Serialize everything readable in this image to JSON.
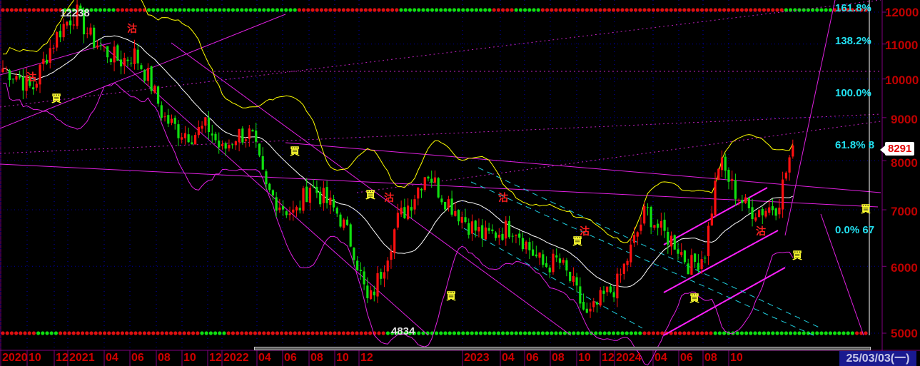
{
  "chart_data": {
    "type": "candlestick",
    "interval": "weekly",
    "y_scale": "log",
    "ylim": [
      4900,
      12300
    ],
    "y_ticks": [
      "12000",
      "11000",
      "10000",
      "9000",
      "8000",
      "7000",
      "6000",
      "5000"
    ],
    "x_ticks": [
      "2020",
      "10",
      "12",
      "2021",
      "04",
      "06",
      "08",
      "10",
      "12",
      "2022",
      "04",
      "06",
      "08",
      "10",
      "12",
      "2023",
      "04",
      "06",
      "08",
      "10",
      "12",
      "2024",
      "04",
      "06",
      "08",
      "10"
    ],
    "monthly_close": {
      "months": [
        "2020-09",
        "2020-10",
        "2020-11",
        "2020-12",
        "2021-01",
        "2021-02",
        "2021-03",
        "2021-04",
        "2021-05",
        "2021-06",
        "2021-07",
        "2021-08",
        "2021-09",
        "2021-10",
        "2021-11",
        "2021-12",
        "2022-01",
        "2022-02",
        "2022-03",
        "2022-04",
        "2022-05",
        "2022-06",
        "2022-07",
        "2022-08",
        "2022-09",
        "2022-10",
        "2022-11",
        "2022-12",
        "2023-01",
        "2023-02",
        "2023-03",
        "2023-04",
        "2023-05",
        "2023-06",
        "2023-07",
        "2023-08",
        "2023-09",
        "2023-10",
        "2023-11",
        "2023-12",
        "2024-01",
        "2024-02",
        "2024-03",
        "2024-04",
        "2024-05",
        "2024-06",
        "2024-07",
        "2024-08",
        "2024-09",
        "2024-10",
        "2024-11",
        "2024-12",
        "2025-01",
        "2025-02",
        "2025-03"
      ],
      "values": [
        10300,
        10100,
        9700,
        10700,
        11500,
        12000,
        11200,
        10800,
        10500,
        10700,
        10000,
        9000,
        8700,
        8600,
        8800,
        8200,
        8600,
        8600,
        7400,
        7100,
        6900,
        7500,
        7200,
        6900,
        6300,
        5400,
        6000,
        6800,
        7200,
        7800,
        7300,
        7000,
        6700,
        6500,
        6600,
        6700,
        6300,
        6000,
        6100,
        5700,
        5200,
        5500,
        5700,
        6300,
        7000,
        6600,
        6400,
        6000,
        6200,
        8000,
        7400,
        7000,
        7000,
        7100,
        8291
      ]
    },
    "annotations": {
      "high_label": "12238",
      "low_label": "4834",
      "last_price": "8291",
      "fib_levels": [
        "161.8%",
        "138.2%",
        "100.0%",
        "61.8% 8",
        "0.0% 67"
      ],
      "buy_signal": "買",
      "sell_signal": "沽"
    },
    "overlays": [
      "moving average (white)",
      "upper band (yellow)",
      "lower band (magenta)",
      "trend lines (magenta/cyan)"
    ],
    "colors": {
      "up": "#ff1010",
      "down": "#10e010",
      "ma": "#ffffff",
      "upper": "#ffff00",
      "lower": "#e020e0",
      "fib": "#22e0f0",
      "axis": "#c00000"
    }
  },
  "current_date": "25/03/03(一)"
}
